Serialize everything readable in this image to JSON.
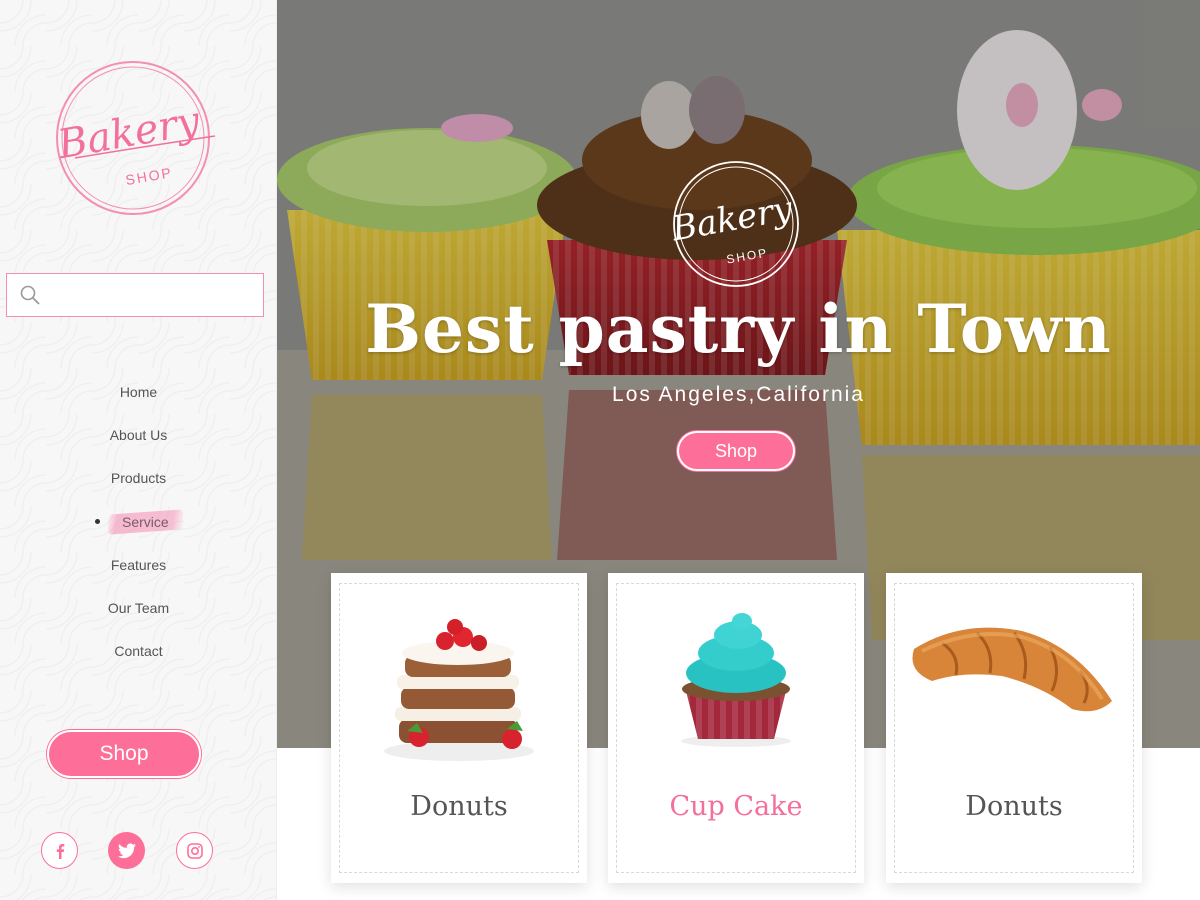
{
  "sidebar": {
    "logo": {
      "word": "Bakery",
      "sub": "SHOP"
    },
    "search": {
      "placeholder": ""
    },
    "nav": [
      {
        "label": "Home"
      },
      {
        "label": "About Us"
      },
      {
        "label": "Products"
      },
      {
        "label": "Service",
        "active": true
      },
      {
        "label": "Features"
      },
      {
        "label": "Our Team"
      },
      {
        "label": "Contact"
      }
    ],
    "shop_label": "Shop",
    "social": [
      "facebook-icon",
      "twitter-icon",
      "instagram-icon"
    ]
  },
  "hero": {
    "logo": {
      "word": "Bakery",
      "sub": "SHOP"
    },
    "title": "Best pastry in Town",
    "subtitle": "Los Angeles,California",
    "shop_label": "Shop"
  },
  "products": [
    {
      "name": "Donuts",
      "image": "layer-cake-strawberries"
    },
    {
      "name": "Cup Cake",
      "image": "teal-frosted-cupcake"
    },
    {
      "name": "Donuts",
      "image": "croissant"
    }
  ],
  "colors": {
    "accent": "#fd6f99",
    "text": "#555555"
  }
}
